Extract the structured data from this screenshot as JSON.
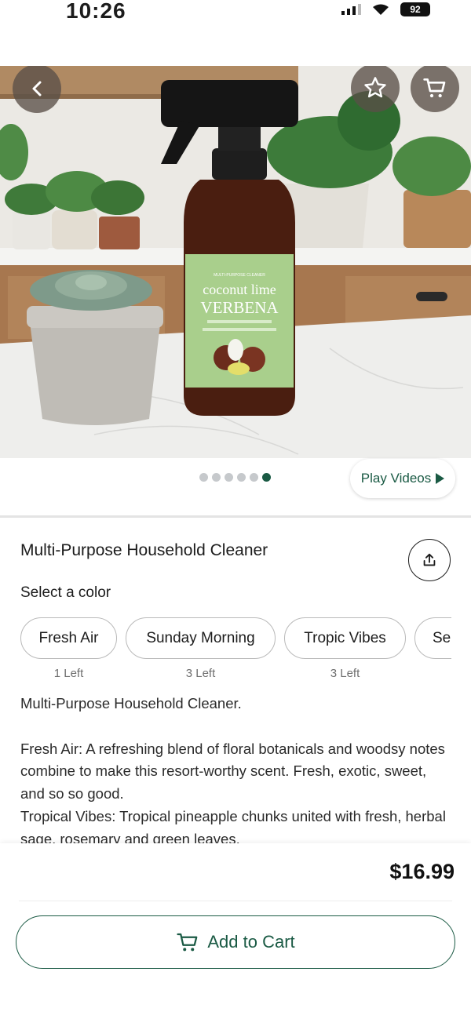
{
  "status_bar": {
    "time": "10:26",
    "battery": "92"
  },
  "hero": {
    "label_top": "MULTI-PURPOSE CLEANER",
    "label_line1": "coconut lime",
    "label_line2": "VERBENA"
  },
  "carousel": {
    "total_dots": 6,
    "active_dot": 6,
    "play_videos_label": "Play Videos"
  },
  "product": {
    "title": "Multi-Purpose Household Cleaner",
    "select_label": "Select a color",
    "options": [
      {
        "name": "Fresh Air",
        "stock": "1 Left"
      },
      {
        "name": "Sunday Morning",
        "stock": "3 Left"
      },
      {
        "name": "Tropic Vibes",
        "stock": "3 Left"
      },
      {
        "name": "Se",
        "stock": ""
      }
    ],
    "description": {
      "intro": "Multi-Purpose Household Cleaner.",
      "fresh_air": "Fresh Air:  A refreshing blend of floral botanicals and woodsy notes combine to make this resort-worthy scent. Fresh, exotic, sweet, and so so good.",
      "tropical_vibes": "Tropical Vibes: Tropical pineapple chunks united with fresh, herbal sage, rosemary and green leaves."
    }
  },
  "footer": {
    "price": "$16.99",
    "add_to_cart_label": "Add to Cart"
  },
  "colors": {
    "accent": "#1a5a44",
    "chip_border": "#b9b9b9",
    "label_green": "#a9cf8c",
    "bottle": "#4a1e10"
  },
  "icons": {
    "back": "chevron-left-icon",
    "favorite": "star-outline-icon",
    "cart": "cart-icon",
    "share": "share-upload-icon",
    "play": "play-triangle-icon"
  }
}
